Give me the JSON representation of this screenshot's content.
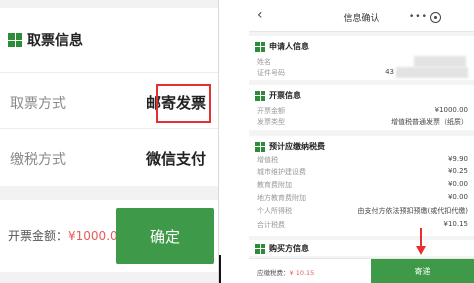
{
  "left": {
    "section_title": "取票信息",
    "rows": [
      {
        "label": "取票方式",
        "value": "邮寄发票"
      },
      {
        "label": "缴税方式",
        "value": "微信支付"
      }
    ],
    "amount_label": "开票金额：",
    "amount_value": "¥1000.00",
    "confirm_label": "确定"
  },
  "right": {
    "title": "信息确认",
    "back_icon": "‹",
    "more_icon": "•••",
    "applicant": {
      "title": "申请人信息",
      "rows": [
        {
          "label": "姓名",
          "value": ""
        },
        {
          "label": "证件号码",
          "value": "43"
        }
      ]
    },
    "invoice": {
      "title": "开票信息",
      "rows": [
        {
          "label": "开票金额",
          "value": "¥1000.00"
        },
        {
          "label": "发票类型",
          "value": "增值税普通发票（纸质）"
        }
      ]
    },
    "tax": {
      "title": "预计应缴纳税费",
      "rows": [
        {
          "label": "增值税",
          "value": "¥9.90"
        },
        {
          "label": "城市维护建设费",
          "value": "¥0.25"
        },
        {
          "label": "教育费附加",
          "value": "¥0.00"
        },
        {
          "label": "地方教育费附加",
          "value": "¥0.00"
        },
        {
          "label": "个人所得税",
          "value": "由支付方依法预扣预缴(或代扣代缴)"
        },
        {
          "label": "合计税费",
          "value": "¥10.15"
        }
      ]
    },
    "buyer": {
      "title": "购买方信息"
    },
    "amount_label": "应缴税费：",
    "amount_value": "¥ 10.15",
    "mail_label": "寄递"
  },
  "colors": {
    "accent_green": "#3e9a48",
    "highlight_red": "#e53030",
    "money_red": "#e85a5a"
  }
}
